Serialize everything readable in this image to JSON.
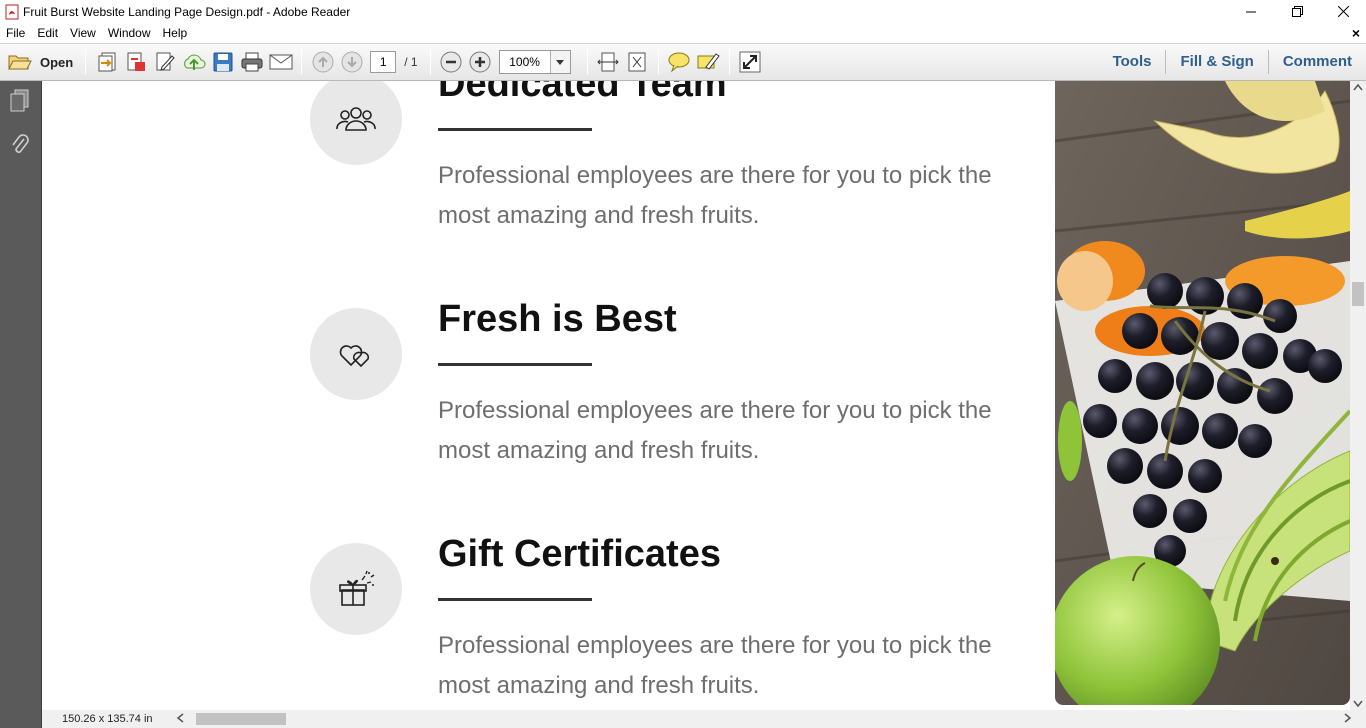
{
  "window": {
    "title": "Fruit Burst Website Landing Page Design.pdf - Adobe Reader"
  },
  "menu": {
    "items": [
      "File",
      "Edit",
      "View",
      "Window",
      "Help"
    ],
    "close_glyph": "×"
  },
  "toolbar": {
    "open_label": "Open",
    "page_current": "1",
    "page_total": "/ 1",
    "zoom": "100%",
    "tools_label": "Tools",
    "fill_sign_label": "Fill & Sign",
    "comment_label": "Comment"
  },
  "document": {
    "features": [
      {
        "title": "Dedicated Team",
        "icon": "team-icon",
        "text": "Professional employees are there for you to pick the most amazing and fresh fruits."
      },
      {
        "title": "Fresh is Best",
        "icon": "hearts-icon",
        "text": "Professional employees are there for you to pick the most amazing and fresh fruits."
      },
      {
        "title": "Gift Certificates",
        "icon": "gift-icon",
        "text": "Professional employees are there for you to pick the most amazing and fresh fruits."
      }
    ]
  },
  "status": {
    "page_size": "150.26 x 135.74 in"
  },
  "colors": {
    "accent_link": "#2d5f8e",
    "nav_panel": "#5a5a5a",
    "icon_circle": "#e8e8e8",
    "body_text": "#6e6e6e"
  }
}
